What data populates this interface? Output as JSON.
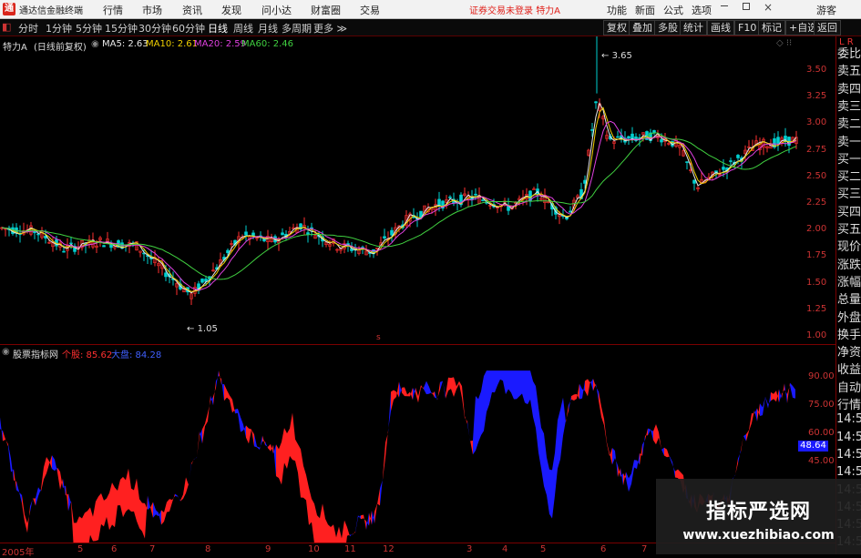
{
  "app": {
    "title": "通达信金融终端",
    "status": "证券交易未登录",
    "stock": "特力A",
    "user": "游客"
  },
  "menu": [
    "行情",
    "市场",
    "资讯",
    "发现",
    "问小达",
    "财富圈",
    "交易"
  ],
  "right_menu": [
    "功能",
    "新面",
    "公式",
    "选项"
  ],
  "periods": [
    "分时",
    "1分钟",
    "5分钟",
    "15分钟",
    "30分钟",
    "60分钟",
    "日线",
    "周线",
    "月线",
    "多周期",
    "更多"
  ],
  "active_period": "日线",
  "right_tools": [
    "复权",
    "叠加",
    "多股",
    "统计",
    "画线",
    "F10",
    "标记",
    "+自选",
    "返回"
  ],
  "main": {
    "name": "特力A",
    "mode": "(日线前复权)",
    "ma": [
      {
        "label": "MA5: 2.63",
        "color": "#e8e8e8"
      },
      {
        "label": "MA10: 2.61",
        "color": "#f0d000"
      },
      {
        "label": "MA20: 2.59",
        "color": "#e040e0"
      },
      {
        "label": "MA60: 2.46",
        "color": "#40d040"
      }
    ],
    "high_label": "3.65",
    "low_label": "1.05",
    "yticks": [
      "3.50",
      "3.25",
      "3.00",
      "2.75",
      "2.50",
      "2.25",
      "2.00",
      "1.75",
      "1.50",
      "1.25",
      "1.00"
    ]
  },
  "sub": {
    "name": "股票指标网",
    "stock_label": "个股: 85.62",
    "market_label": "大盘: 84.28",
    "yticks": [
      "90.00",
      "75.00",
      "60.00",
      "45.00"
    ],
    "cursor_value": "48.64"
  },
  "sidebar": [
    "委比",
    "卖五",
    "卖四",
    "卖三",
    "卖二",
    "卖一",
    "买一",
    "买二",
    "买三",
    "买四",
    "买五",
    "现价",
    "涨跌",
    "涨幅",
    "总量",
    "外盘",
    "换手",
    "净资",
    "收益",
    "自动",
    "行情",
    "14:5",
    "14:5",
    "14:5",
    "14:5",
    "14:5",
    "14:5",
    "14:5",
    "14:5"
  ],
  "xaxis": [
    "2005年",
    "5",
    "6",
    "7",
    "8",
    "9",
    "10",
    "11",
    "12",
    "3",
    "4",
    "5",
    "6",
    "7"
  ],
  "watermark": {
    "line1": "指标严选网",
    "line2": "www.xuezhibiao.com"
  },
  "colors": {
    "up": "#ff2020",
    "down": "#1a1aff",
    "ma60": "#40d040",
    "ma20": "#e040e0",
    "ma10": "#f0d000",
    "ma5": "#e8e8e8"
  }
}
